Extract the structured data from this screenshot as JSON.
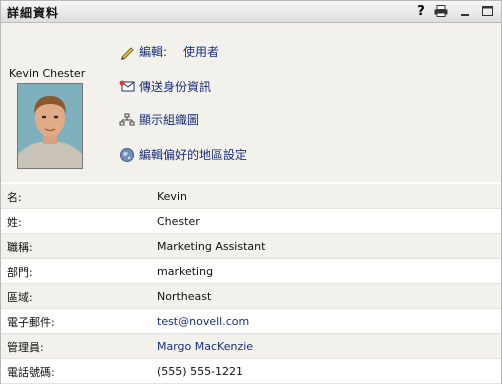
{
  "window": {
    "title": "詳細資料",
    "help_label": "?"
  },
  "profile": {
    "name": "Kevin Chester"
  },
  "actions": [
    {
      "label": "編輯:",
      "extra": "使用者",
      "icon": "pencil-icon"
    },
    {
      "label": "傳送身份資訊",
      "icon": "email-icon"
    },
    {
      "label": "顯示組織圖",
      "icon": "org-chart-icon"
    },
    {
      "label": "編輯偏好的地區設定",
      "icon": "globe-icon"
    }
  ],
  "details": [
    {
      "label": "名:",
      "value": "Kevin"
    },
    {
      "label": "姓:",
      "value": "Chester"
    },
    {
      "label": "職稱:",
      "value": "Marketing Assistant"
    },
    {
      "label": "部門:",
      "value": "marketing"
    },
    {
      "label": "區域:",
      "value": "Northeast"
    },
    {
      "label": "電子郵件:",
      "value": "test@novell.com"
    },
    {
      "label": "管理員:",
      "value": "Margo MacKenzie"
    },
    {
      "label": "電話號碼:",
      "value": "(555) 555-1221"
    }
  ],
  "colors": {
    "link": "#1a2f7a",
    "row_alt": "#f2f1ec"
  }
}
